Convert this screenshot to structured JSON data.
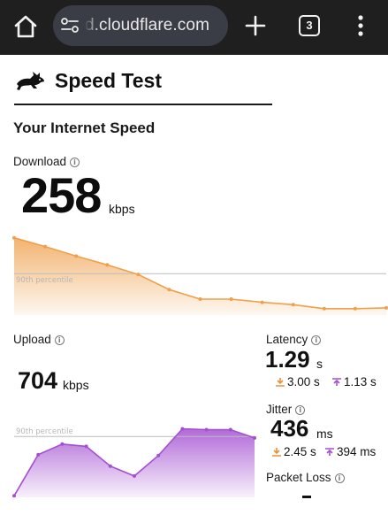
{
  "browser": {
    "url": "d.cloudflare.com",
    "tab_count": "3",
    "icons": {
      "home": "home-icon",
      "site_settings": "tune-icon",
      "new_tab": "plus-icon",
      "tabs": "tab-switcher-icon",
      "menu": "more-vert-icon"
    }
  },
  "page": {
    "title": "Speed Test",
    "logo_icon": "rabbit-icon",
    "section_title": "Your Internet Speed"
  },
  "download": {
    "label": "Download",
    "value": "258",
    "unit": "kbps",
    "percentile_label": "90th percentile",
    "color": "#f0a04b",
    "chart_data": {
      "type": "area",
      "y_relative": [
        0.97,
        0.86,
        0.74,
        0.63,
        0.51,
        0.32,
        0.2,
        0.2,
        0.16,
        0.13,
        0.08,
        0.08,
        0.09
      ],
      "percentile_level": 0.52
    }
  },
  "upload": {
    "label": "Upload",
    "value": "704",
    "unit": "kbps",
    "percentile_label": "90th percentile",
    "color": "#a44fd1",
    "chart_data": {
      "type": "area",
      "y_relative": [
        0.02,
        0.56,
        0.7,
        0.67,
        0.41,
        0.28,
        0.55,
        0.9,
        0.89,
        0.89,
        0.78
      ],
      "percentile_level": 0.8
    }
  },
  "latency": {
    "label": "Latency",
    "value": "1.29",
    "unit": "s",
    "down_value": "3.00 s",
    "up_value": "1.13 s"
  },
  "jitter": {
    "label": "Jitter",
    "value": "436",
    "unit": "ms",
    "down_value": "2.45 s",
    "up_value": "394 ms"
  },
  "packet_loss": {
    "label": "Packet Loss",
    "value": "-"
  },
  "colors": {
    "chrome_bg": "#1f1f1f",
    "url_pill": "#3a3d45",
    "download_orange": "#f0a04b",
    "upload_purple": "#a44fd1"
  }
}
